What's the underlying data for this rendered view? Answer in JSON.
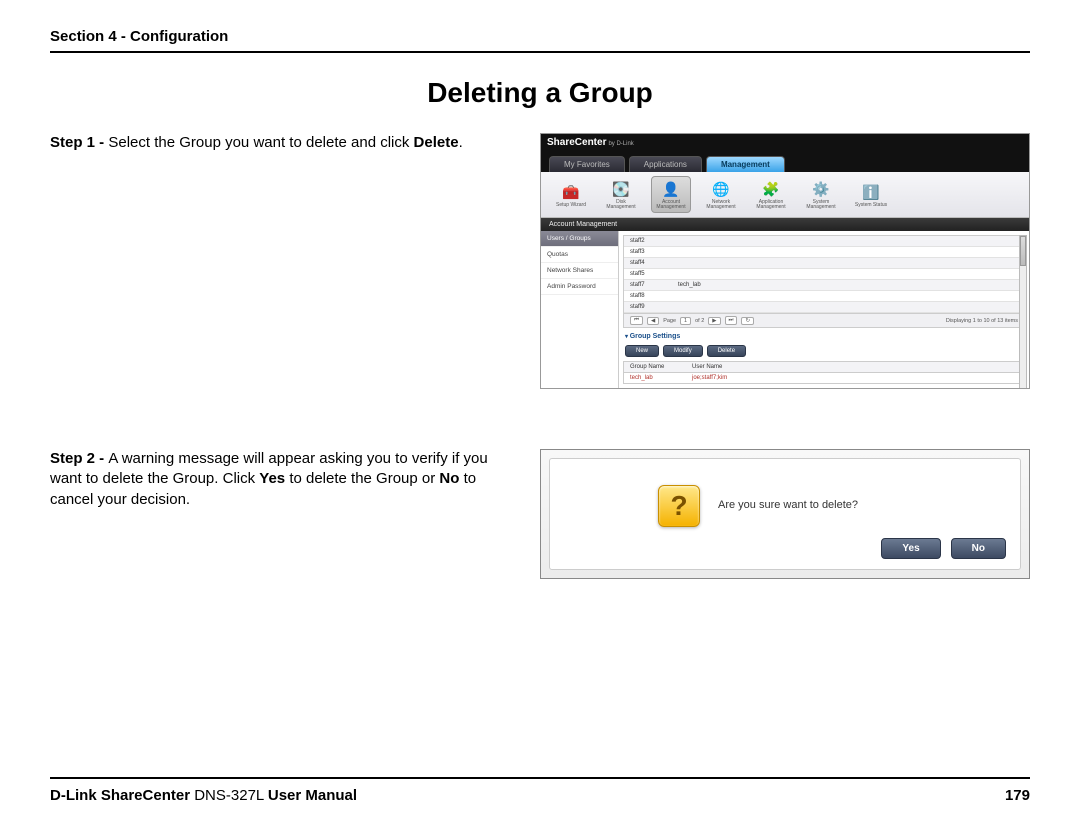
{
  "header": {
    "section": "Section 4 - Configuration"
  },
  "title": "Deleting a Group",
  "steps": {
    "s1": {
      "label": "Step 1 - ",
      "text_a": "Select the Group you want to delete and click ",
      "bold_a": "Delete",
      "text_b": "."
    },
    "s2": {
      "label": "Step 2 - ",
      "text_a": "A warning message will appear asking you to verify if you want to delete the Group. Click ",
      "bold_a": "Yes",
      "text_b": " to delete the Group or ",
      "bold_b": "No",
      "text_c": " to cancel your decision."
    }
  },
  "sharecenter": {
    "brand": "ShareCenter",
    "brand_sub": "by D-Link",
    "tabs": {
      "fav": "My Favorites",
      "apps": "Applications",
      "mgmt": "Management"
    },
    "icons": {
      "setup": "Setup Wizard",
      "disk": "Disk Management",
      "account": "Account Management",
      "network": "Network Management",
      "app": "Application Management",
      "system": "System Management",
      "status": "System Status"
    },
    "section_title": "Account Management",
    "sidebar": {
      "users": "Users / Groups",
      "quotas": "Quotas",
      "shares": "Network Shares",
      "admin": "Admin Password"
    },
    "rows": [
      {
        "user": "staff2",
        "group": ""
      },
      {
        "user": "staff3",
        "group": ""
      },
      {
        "user": "staff4",
        "group": ""
      },
      {
        "user": "staff5",
        "group": ""
      },
      {
        "user": "staff7",
        "group": "tech_lab"
      },
      {
        "user": "staff8",
        "group": ""
      },
      {
        "user": "staff9",
        "group": ""
      }
    ],
    "pager": {
      "page_label": "Page",
      "page": "1",
      "of": "of 2",
      "refresh": "↻",
      "info": "Displaying 1 to 10 of 13 items"
    },
    "group_settings_title": "Group Settings",
    "buttons": {
      "new": "New",
      "modify": "Modify",
      "delete": "Delete"
    },
    "group_table": {
      "head_name": "Group Name",
      "head_user": "User Name",
      "row_name": "tech_lab",
      "row_user": "joe;staff7;kim"
    }
  },
  "dialog": {
    "text": "Are you sure want to delete?",
    "yes": "Yes",
    "no": "No"
  },
  "footer": {
    "brand": "D-Link ShareCenter",
    "model": " DNS-327L ",
    "suffix": "User Manual",
    "page": "179"
  }
}
